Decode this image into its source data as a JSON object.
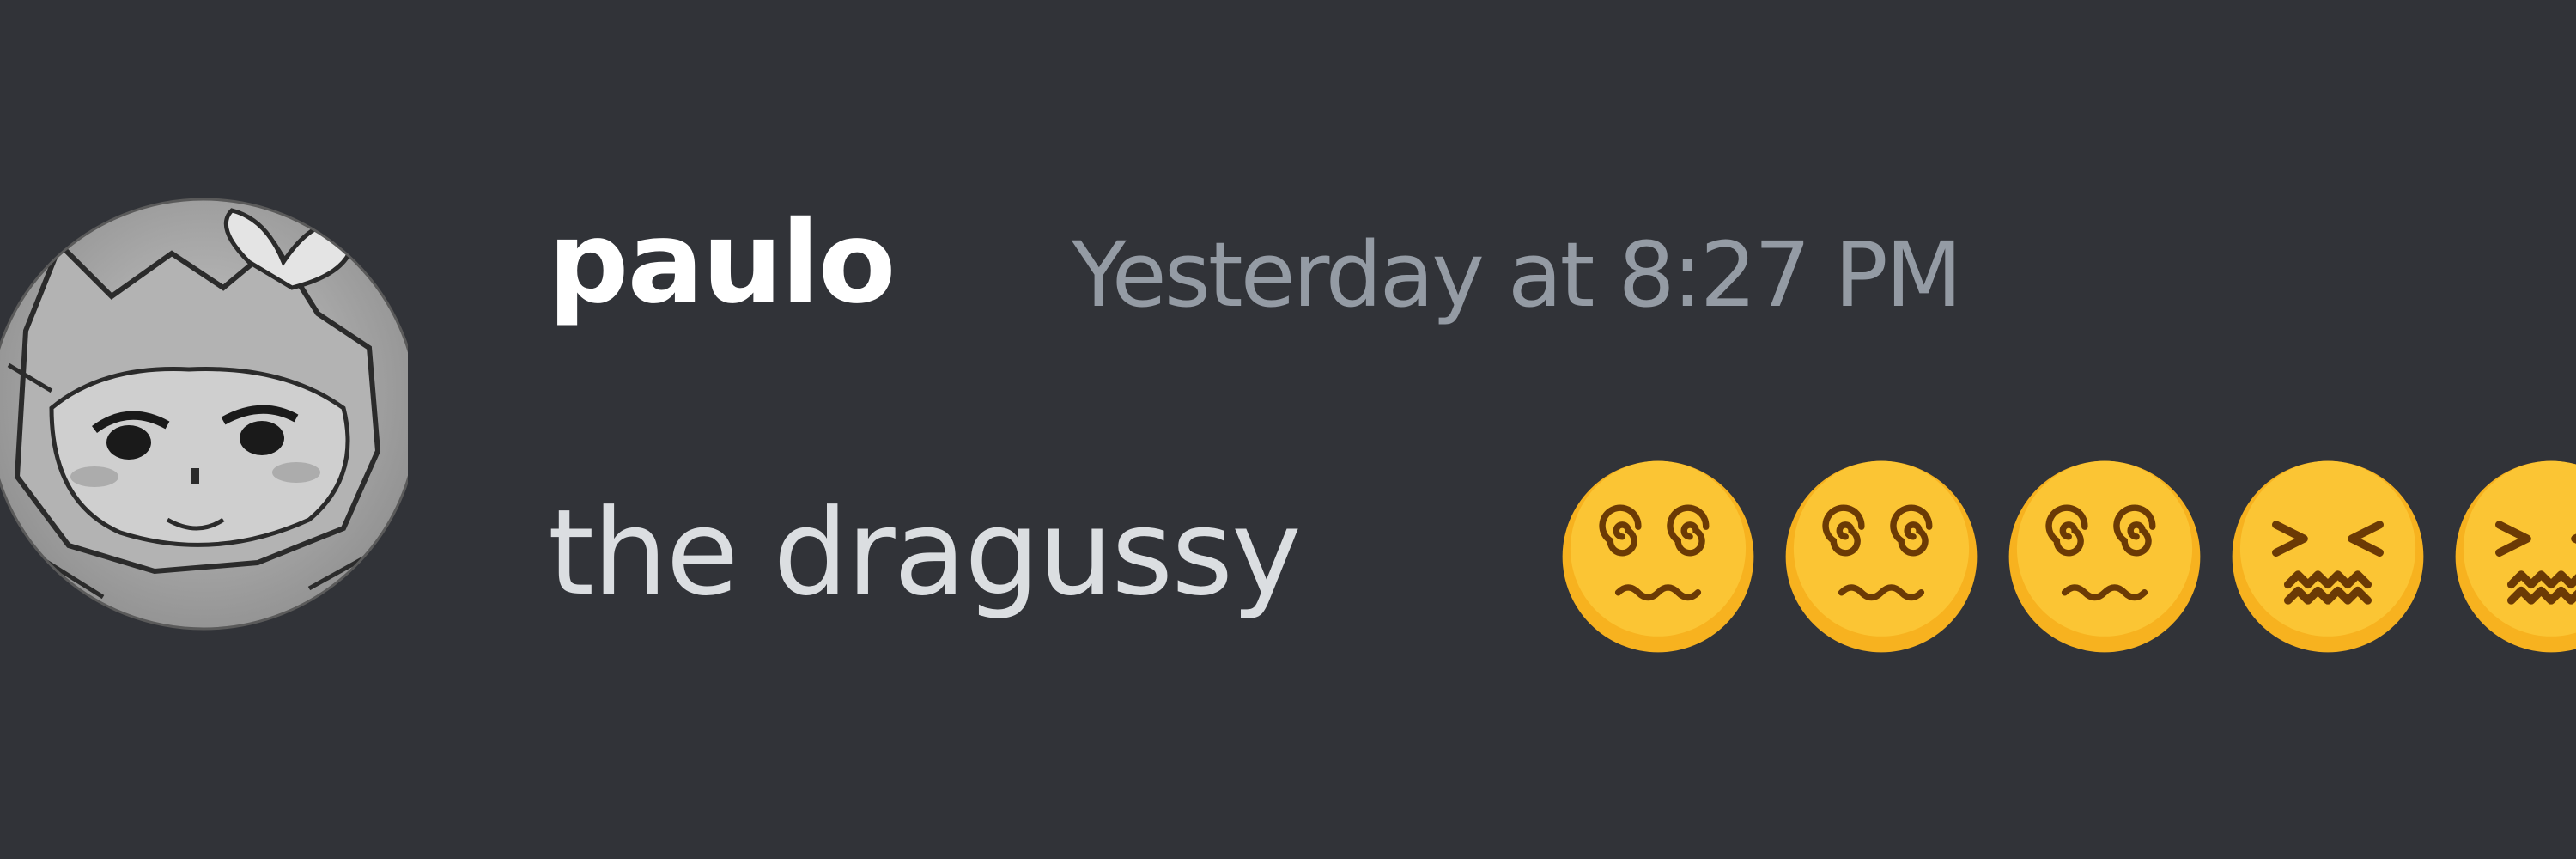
{
  "message": {
    "author": "paulo",
    "timestamp": "Yesterday at 8:27 PM",
    "text": "the dragussy",
    "emojis": [
      "face-with-spiral-eyes",
      "face-with-spiral-eyes",
      "face-with-spiral-eyes",
      "confounded-face",
      "confounded-face"
    ]
  },
  "colors": {
    "background": "#313338",
    "username": "#ffffff",
    "timestamp": "#949ba4",
    "text": "#dbdee1",
    "emoji_face": "#f7b21f"
  },
  "icons": {
    "avatar": "grayscale-cat-drawing-avatar"
  }
}
